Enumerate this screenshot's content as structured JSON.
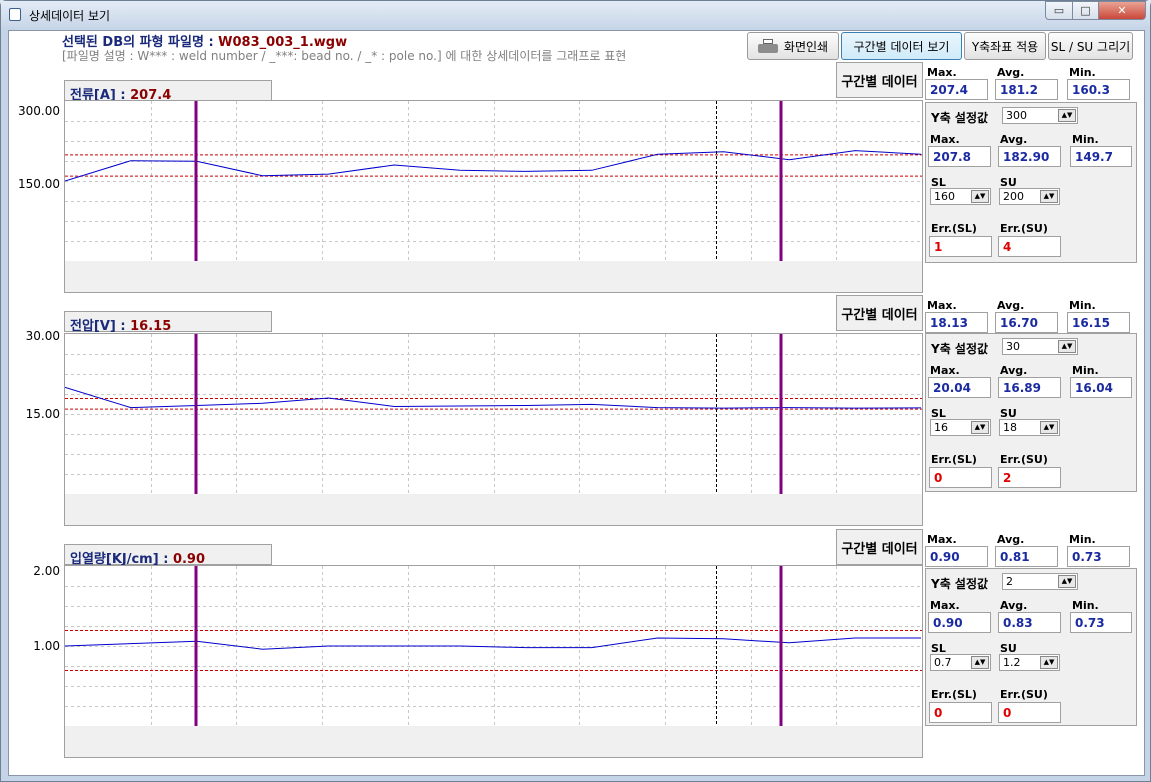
{
  "window": {
    "title": "상세데이터 보기",
    "controls": {
      "minimize": "▭",
      "maximize": "□",
      "close": "✕"
    }
  },
  "header": {
    "title_prefix": "선택된 DB의 파형 파일명 : ",
    "file_name": "W083_003_1.wgw",
    "description": "[파일명 설명 : W*** : weld number / _***: bead no. / _* : pole no.] 에 대한 상세데이터를 그래프로 표현"
  },
  "toolbar": {
    "print_label": "화면인쇄",
    "section_view_label": "구간별 데이터 보기",
    "y_apply_label": "Y축좌표 적용",
    "slsu_draw_label": "SL / SU 그리기"
  },
  "labels": {
    "section_data": "구간별 데이터",
    "max": "Max.",
    "avg": "Avg.",
    "min": "Min.",
    "y_setting": "Y축 설정값",
    "sl": "SL",
    "su": "SU",
    "err_sl": "Err.(SL)",
    "err_su": "Err.(SU)"
  },
  "colors": {
    "signal": "#0000cc",
    "limit": "#cc0000",
    "marker": "#800080",
    "cursor": "#000000"
  },
  "charts": [
    {
      "title": "전류[A] : ",
      "current_value": "207.4",
      "ytick_top": "300.00",
      "ytick_mid": "150.00",
      "section": {
        "max": "207.4",
        "avg": "181.2",
        "min": "160.3"
      },
      "y_setting": "300",
      "stats": {
        "max": "207.8",
        "avg": "182.90",
        "min": "149.7"
      },
      "sl": "160",
      "su": "200",
      "err_sl": "1",
      "err_su": "4"
    },
    {
      "title": "전압[V] : ",
      "current_value": "16.15",
      "ytick_top": "30.00",
      "ytick_mid": "15.00",
      "section": {
        "max": "18.13",
        "avg": "16.70",
        "min": "16.15"
      },
      "y_setting": "30",
      "stats": {
        "max": "20.04",
        "avg": "16.89",
        "min": "16.04"
      },
      "sl": "16",
      "su": "18",
      "err_sl": "0",
      "err_su": "2"
    },
    {
      "title": "입열량[KJ/cm] : ",
      "current_value": "0.90",
      "ytick_top": "2.00",
      "ytick_mid": "1.00",
      "section": {
        "max": "0.90",
        "avg": "0.81",
        "min": "0.73"
      },
      "y_setting": "2",
      "stats": {
        "max": "0.90",
        "avg": "0.83",
        "min": "0.73"
      },
      "sl": "0.7",
      "su": "1.2",
      "err_sl": "0",
      "err_su": "0"
    }
  ],
  "chart_data": [
    {
      "type": "line",
      "title": "전류[A] : 207.4",
      "ylim": [
        0,
        300
      ],
      "y_ticks": [
        "300.00",
        "150.00"
      ],
      "limits": {
        "sl": 160,
        "su": 200
      },
      "series": [
        {
          "values": [
            150,
            188,
            187,
            160,
            163,
            180,
            170,
            168,
            170,
            200,
            205,
            190,
            207,
            200
          ]
        }
      ],
      "grid": true
    },
    {
      "type": "line",
      "title": "전압[V] : 16.15",
      "ylim": [
        0,
        30
      ],
      "y_ticks": [
        "30.00",
        "15.00"
      ],
      "limits": {
        "sl": 16,
        "su": 18
      },
      "series": [
        {
          "values": [
            20,
            16.2,
            16.6,
            17,
            18,
            16.4,
            16.5,
            16.6,
            16.8,
            16.2,
            16.1,
            16.2,
            16.1,
            16.15
          ]
        }
      ],
      "grid": true
    },
    {
      "type": "line",
      "title": "입열량[KJ/cm] : 0.90",
      "ylim": [
        0,
        2
      ],
      "y_ticks": [
        "2.00",
        "1.00"
      ],
      "limits": {
        "sl": 0.7,
        "su": 1.2
      },
      "series": [
        {
          "values": [
            1.0,
            1.03,
            1.06,
            0.96,
            1.0,
            1.0,
            1.0,
            0.98,
            0.98,
            1.1,
            1.09,
            1.04,
            1.1,
            1.1
          ]
        }
      ],
      "grid": true
    }
  ]
}
